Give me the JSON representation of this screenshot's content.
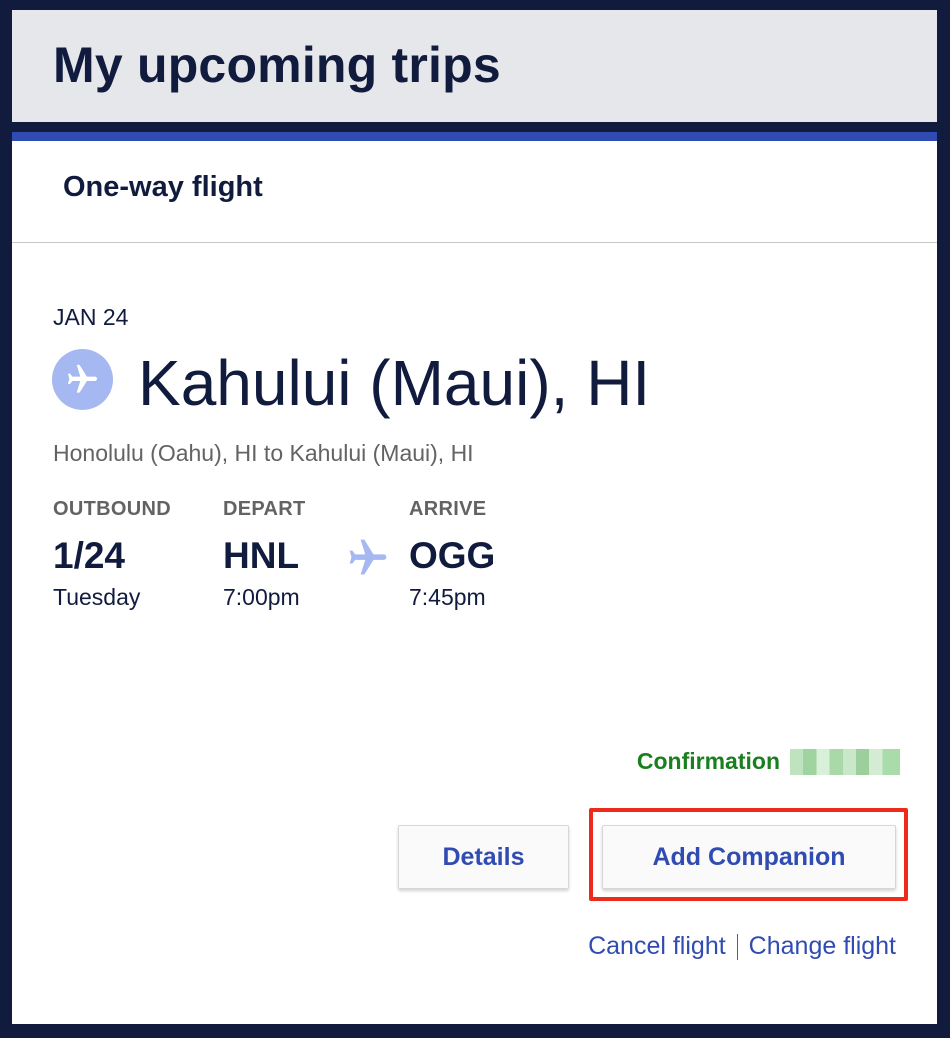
{
  "header": {
    "title": "My upcoming trips"
  },
  "trip": {
    "type_label": "One-way flight",
    "date": "JAN 24",
    "destination": "Kahului (Maui), HI",
    "route": "Honolulu (Oahu), HI to Kahului (Maui), HI",
    "outbound": {
      "label": "OUTBOUND",
      "date": "1/24",
      "day": "Tuesday"
    },
    "depart": {
      "label": "DEPART",
      "code": "HNL",
      "time": "7:00pm"
    },
    "arrive": {
      "label": "ARRIVE",
      "code": "OGG",
      "time": "7:45pm"
    },
    "confirmation_label": "Confirmation"
  },
  "actions": {
    "details_label": "Details",
    "add_companion_label": "Add Companion",
    "cancel_label": "Cancel flight",
    "change_label": "Change flight"
  },
  "icons": {
    "destination": "airplane-icon",
    "route_arrow": "airplane-icon"
  },
  "colors": {
    "navy": "#111b3e",
    "brand_blue": "#304cb2",
    "header_gray": "#e6e7ea",
    "confirmation_green": "#1a7f1e",
    "highlight_red": "#ee2a1b",
    "icon_light_blue": "#a5b8f1"
  }
}
